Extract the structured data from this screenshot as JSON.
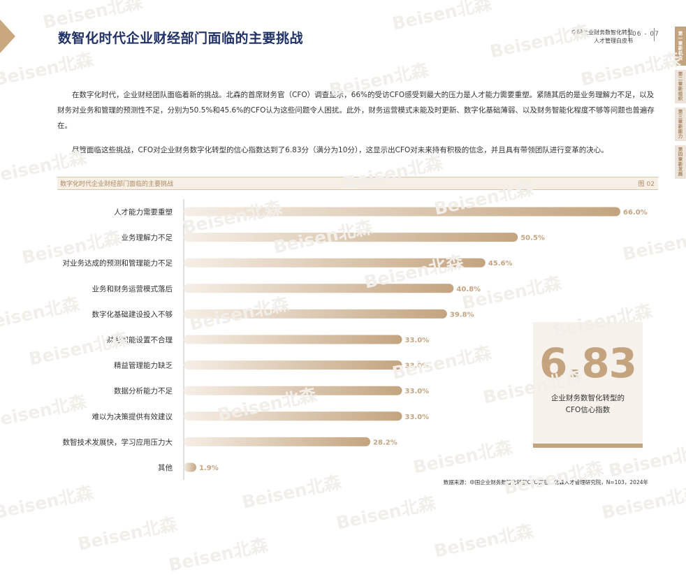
{
  "page": {
    "title": "数智化时代企业财经部门面临的主要挑战",
    "doc_title_line1": "中国企业财务数智化转型",
    "doc_title_line2": "人才管理白皮书",
    "page_numbers": "06 - 07"
  },
  "chapter_nav": [
    {
      "label": "第一章 新机会",
      "active": true
    },
    {
      "label": "第二章 新组织",
      "active": false
    },
    {
      "label": "第三章 新能力",
      "active": false
    },
    {
      "label": "第四章 新发展",
      "active": false
    }
  ],
  "intro": {
    "paragraph1": "在数字化时代，企业财经团队面临着新的挑战。北森的首席财务官（CFO）调查显示，66%的受访CFO感受到最大的压力是人才能力需要重塑。紧随其后的是业务理解力不足，以及财务对业务和管理的预测性不足，分别为50.5%和45.6%的CFO认为这些问题令人困扰。此外，财务运营模式未能及时更新、数字化基础薄弱、以及财务智能化程度不够等问题也普遍存在。",
    "paragraph2": "尽管面临这些挑战，CFO对企业财务数字化转型的信心指数达到了6.83分（满分为10分），这显示出CFO对未来持有积极的信念，并且具有带领团队进行变革的决心。"
  },
  "figure": {
    "title": "数字化时代企业财经部门面临的主要挑战",
    "label": "图 02"
  },
  "chart_data": {
    "type": "bar",
    "orientation": "horizontal",
    "categories": [
      "人才能力需要重塑",
      "业务理解力不足",
      "对业务达成的预测和管理能力不足",
      "业务和财务运营模式落后",
      "数字化基础建设投入不够",
      "财务职能设置不合理",
      "精益管理能力缺乏",
      "数据分析能力不足",
      "难以为决策提供有效建议",
      "数智技术发展快，学习应用压力大",
      "其他"
    ],
    "values": [
      66.0,
      50.5,
      45.6,
      40.8,
      39.8,
      33.0,
      33.0,
      33.0,
      33.0,
      28.2,
      1.9
    ],
    "value_labels": [
      "66.0%",
      "50.5%",
      "45.6%",
      "40.8%",
      "39.8%",
      "33.0%",
      "33.0%",
      "33.0%",
      "33.0%",
      "28.2%",
      "1.9%"
    ],
    "unit": "%",
    "xlim": [
      0,
      66
    ],
    "grid": false,
    "bar_gradient": [
      "#f6efe7",
      "#c3a47f"
    ],
    "label_color": "#c3a47f"
  },
  "callout": {
    "value": "6.83",
    "caption_line1": "企业财务数智化转型的",
    "caption_line2": "CFO信心指数"
  },
  "source": "数据来源：中国企业财务数智化转型CFO调查，北森人才管理研究院，N=103，2024年",
  "watermark_text": "Beisen北森",
  "colors": {
    "title": "#1f3167",
    "accent": "#c3a47f",
    "accent_light": "#f6f1eb"
  }
}
